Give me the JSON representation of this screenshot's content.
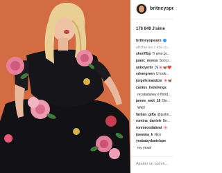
{
  "header": {
    "username": "britneyspears"
  },
  "likes": "176 849 J'aime",
  "caption": {
    "username": "britneyspears",
    "verified_icon": "verified-badge-icon"
  },
  "load_more": "afficher les 1 456 co...",
  "comments": [
    {
      "username": "sheriffbp",
      "text": "Ti amo gr..."
    },
    {
      "username": "juanc_reyess",
      "text": "Soo p..."
    },
    {
      "username": "anboyerbr",
      "text": "✈️🌸🦋❤️"
    },
    {
      "username": "edvergreen",
      "text": "U look..."
    },
    {
      "username": "jorgefernandzm",
      "text": "🌸🦋"
    },
    {
      "username": "cantos_hemmings",
      "text": ""
    },
    {
      "username": "",
      "text": "recatadaney é florid..."
    },
    {
      "username": "james_watt_16",
      "text": "Die..."
    },
    {
      "username": "",
      "text": "Welt!"
    },
    {
      "username": "fardan_gifta",
      "text": "@justin..."
    },
    {
      "username": "romina_daniele",
      "text": "Be..."
    },
    {
      "username": "ronnieondabeat",
      "text": "🌸"
    },
    {
      "username": "joeanna_k",
      "text": "Nice"
    },
    {
      "username": "yeababydanielspe",
      "text": ""
    },
    {
      "username": "",
      "text": "my yeaa!"
    }
  ],
  "footer": {
    "comment_placeholder": "Ajouter un comm..."
  }
}
